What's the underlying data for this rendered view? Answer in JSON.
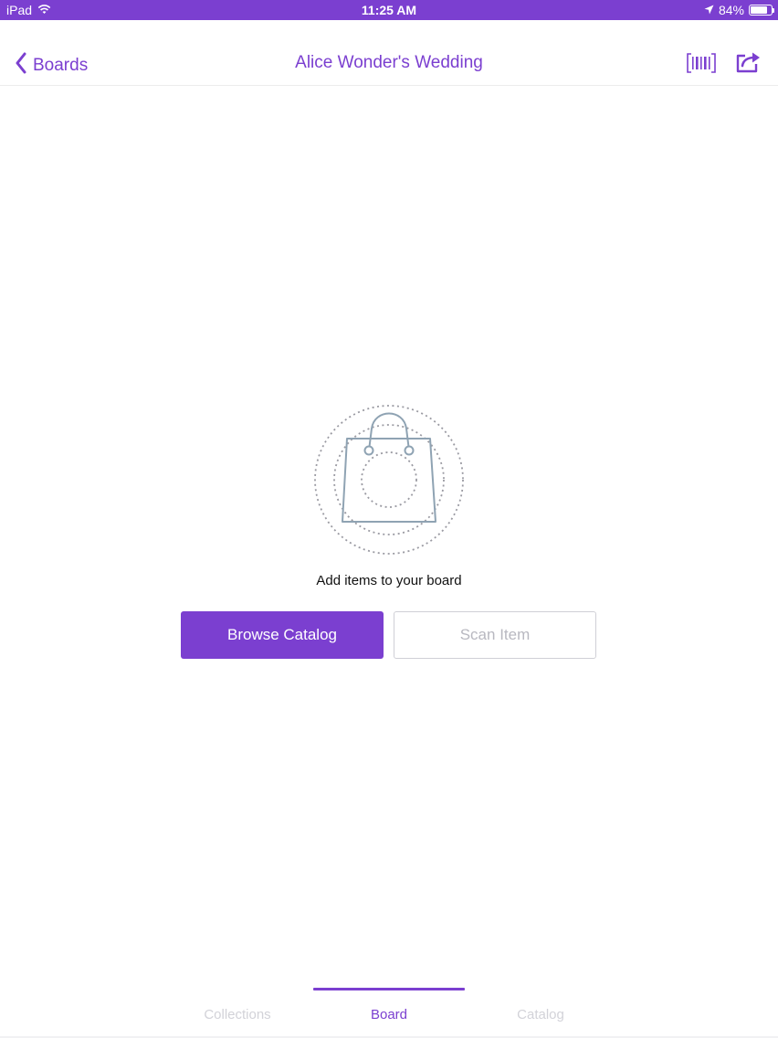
{
  "status_bar": {
    "device": "iPad",
    "time": "11:25 AM",
    "battery": "84%",
    "battery_level": 0.84
  },
  "nav": {
    "back_label": "Boards",
    "title": "Alice Wonder's Wedding"
  },
  "empty_state": {
    "message": "Add items to your board",
    "primary_button": "Browse Catalog",
    "secondary_button": "Scan Item"
  },
  "tabs": [
    {
      "label": "Collections",
      "active": false
    },
    {
      "label": "Board",
      "active": true
    },
    {
      "label": "Catalog",
      "active": false
    }
  ],
  "colors": {
    "accent": "#7b3fd0",
    "inactive_tab": "#d2d2d8",
    "illustration": "#8fa3b3"
  },
  "icons": {
    "wifi": "wifi-icon",
    "location": "location-arrow-icon",
    "battery": "battery-icon",
    "back": "chevron-left-icon",
    "barcode": "barcode-icon",
    "share": "share-icon",
    "bag": "shopping-bag-icon"
  }
}
